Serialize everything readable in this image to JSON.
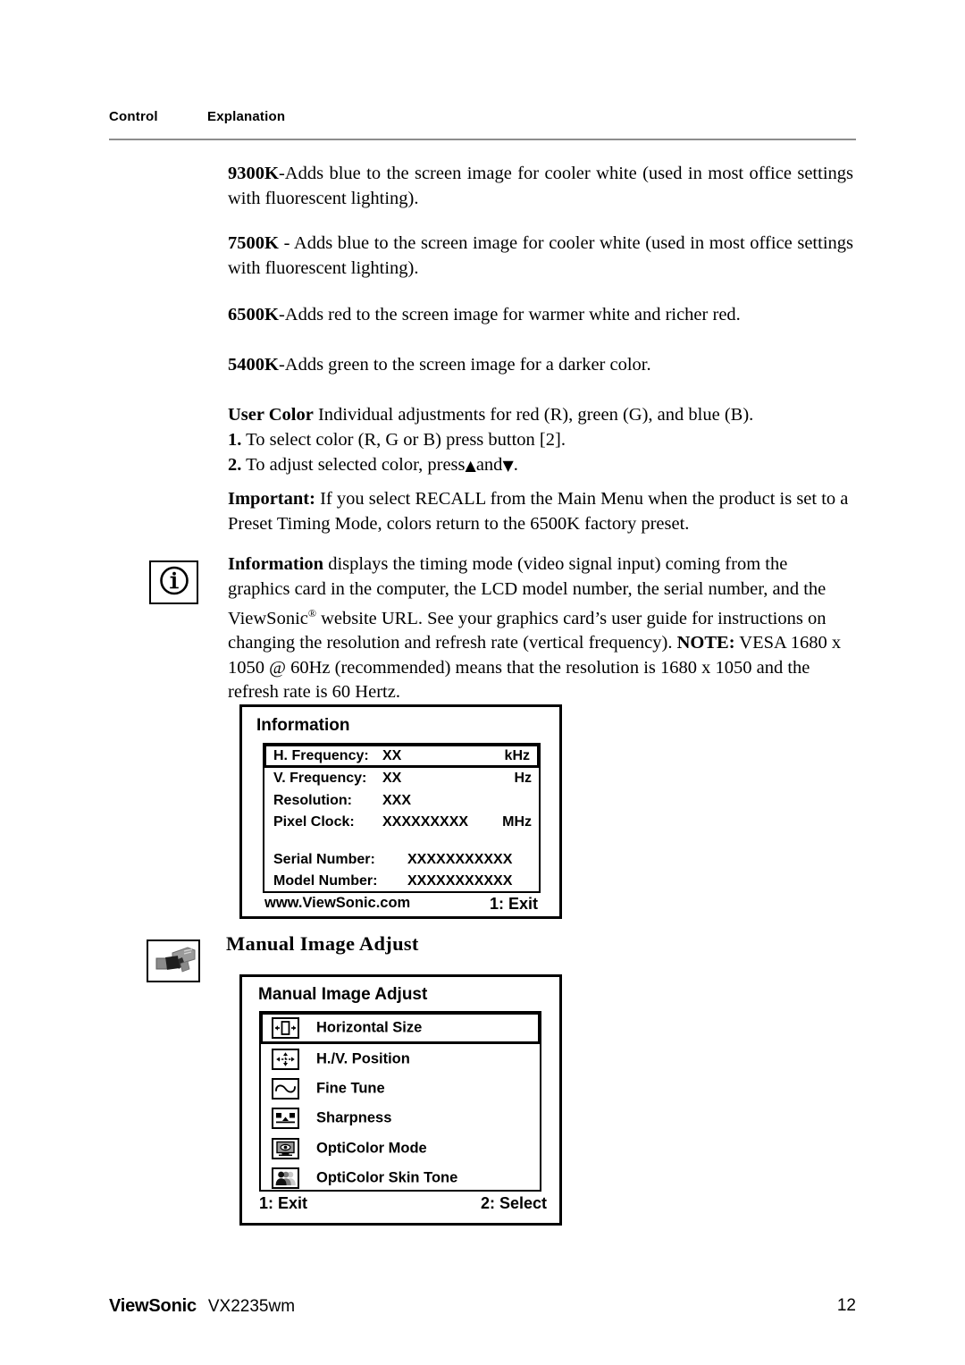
{
  "header": {
    "col_control": "Control",
    "col_explanation": "Explanation"
  },
  "paragraphs": {
    "p9300_label": "9300K",
    "p9300_text": "-Adds blue to the screen image for cooler white (used in most office settings with fluorescent lighting).",
    "p7500_label": "7500K",
    "p7500_text": " - Adds blue to the screen image for cooler white (used in most office settings with fluorescent lighting).",
    "p6500_label": "6500K",
    "p6500_text": "-Adds red to the screen image for warmer white and richer red.",
    "p5400_label": "5400K",
    "p5400_text": "-Adds green to the screen image for a darker color."
  },
  "user_color": {
    "label": "User Color",
    "intro": "  Individual adjustments for red (R), green (G),  and blue (B).",
    "step1_num": "1.",
    "step1_text": " To select color (R, G or B) press button [2].",
    "step2_num": "2.",
    "step2_text_a": " To adjust selected color, press",
    "step2_up": "▲",
    "step2_and": "and",
    "step2_down": "▼",
    "step2_text_b": ".",
    "important_label": "Important:",
    "important_text": " If you select RECALL from the Main Menu when the product is set to a Preset Timing Mode, colors return to the 6500K factory preset."
  },
  "information_section": {
    "icon_name": "information-icon",
    "icon_glyph": "ⓘ",
    "label": "Information",
    "text": " displays the timing mode (video signal input) coming from the graphics card in the computer, the LCD model number, the serial number, and the ViewSonic",
    "registered": "®",
    "text_cont": " website URL. See your graphics card’s user guide for instructions on changing the resolution and refresh rate (vertical frequency).",
    "note_label": "NOTE:",
    "note_text": " VESA 1680 x 1050 @ 60Hz (recommended) means that the resolution is 1680 x 1050 and the refresh rate is 60 Hertz."
  },
  "osd_information": {
    "title": "Information",
    "rows": [
      {
        "label": "H. Frequency:",
        "value": "XX",
        "unit": "kHz",
        "selected": true
      },
      {
        "label": "V. Frequency:",
        "value": "XX",
        "unit": "Hz",
        "selected": false
      },
      {
        "label": "Resolution:",
        "value": "XXX",
        "unit": "",
        "selected": false
      },
      {
        "label": "Pixel Clock:",
        "value": "XXXXXXXXX",
        "unit": "MHz",
        "selected": false
      }
    ],
    "serial_label": "Serial Number:",
    "serial_value": "XXXXXXXXXXX",
    "model_label": "Model Number:",
    "model_value": "XXXXXXXXXXX",
    "footer_left": "www.ViewSonic.com",
    "footer_right": "1: Exit"
  },
  "manual_image_adjust": {
    "icon_name": "spray-gun-icon",
    "heading": "Manual Image Adjust",
    "osd_title": "Manual Image Adjust",
    "items": [
      {
        "label": "Horizontal Size",
        "icon": "horizontal-size-icon",
        "selected": true
      },
      {
        "label": "H./V. Position",
        "icon": "hv-position-icon",
        "selected": false
      },
      {
        "label": "Fine Tune",
        "icon": "fine-tune-icon",
        "selected": false
      },
      {
        "label": "Sharpness",
        "icon": "sharpness-icon",
        "selected": false
      },
      {
        "label": "OptiColor Mode",
        "icon": "opticolor-mode-icon",
        "selected": false
      },
      {
        "label": "OptiColor Skin Tone",
        "icon": "opticolor-skin-tone-icon",
        "selected": false
      }
    ],
    "footer_left": "1: Exit",
    "footer_right": "2: Select"
  },
  "page_footer": {
    "brand": "ViewSonic",
    "model": "VX2235wm",
    "page_number": "12"
  },
  "colors": {
    "ink": "#000000",
    "rule": "#8d8d8d",
    "icon_grey_dark": "#555555",
    "icon_grey_mid": "#8c8c8c",
    "icon_grey_light": "#c9c9c9"
  }
}
